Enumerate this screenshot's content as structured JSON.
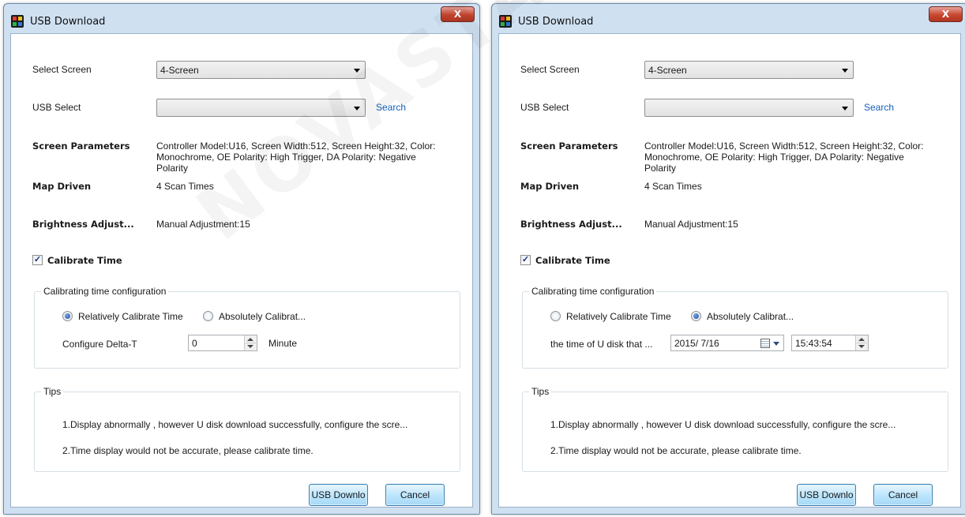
{
  "watermark": "NOVASTAR TECH CO., LTD",
  "colors": {
    "link": "#1560bd",
    "dialog_frame": "#cfe0f1",
    "close": "#c8472f"
  },
  "dialog_left": {
    "title": "USB Download",
    "close_label": "X",
    "select_screen_label": "Select Screen",
    "select_screen_value": "4-Screen",
    "usb_select_label": "USB Select",
    "usb_select_value": "",
    "search_label": "Search",
    "screen_params_label": "Screen Parameters",
    "screen_params_value": "Controller Model:U16, Screen Width:512, Screen Height:32, Color: Monochrome, OE Polarity: High Trigger, DA Polarity: Negative Polarity",
    "map_driven_label": "Map Driven",
    "map_driven_value": "4 Scan Times",
    "brightness_label": "Brightness Adjust...",
    "brightness_value": "Manual Adjustment:15",
    "calibrate_label": "Calibrate Time",
    "calibrate_checked": true,
    "calib_group_title": "Calibrating time configuration",
    "radio_relative": "Relatively Calibrate Time",
    "radio_absolute": "Absolutely Calibrat...",
    "selected_mode": "relative",
    "delta_label": "Configure Delta-T",
    "delta_value": "0",
    "delta_unit": "Minute",
    "tips_title": "Tips",
    "tip1": "1.Display abnormally , however U disk download successfully, configure the scre...",
    "tip2": "2.Time display would not be accurate, please calibrate time.",
    "download_button": "USB Downlo",
    "cancel_button": "Cancel"
  },
  "dialog_right": {
    "title": "USB Download",
    "close_label": "X",
    "select_screen_label": "Select Screen",
    "select_screen_value": "4-Screen",
    "usb_select_label": "USB Select",
    "usb_select_value": "",
    "search_label": "Search",
    "screen_params_label": "Screen Parameters",
    "screen_params_value": "Controller Model:U16, Screen Width:512, Screen Height:32, Color: Monochrome, OE Polarity: High Trigger, DA Polarity: Negative Polarity",
    "map_driven_label": "Map Driven",
    "map_driven_value": "4 Scan Times",
    "brightness_label": "Brightness Adjust...",
    "brightness_value": "Manual Adjustment:15",
    "calibrate_label": "Calibrate Time",
    "calibrate_checked": true,
    "calib_group_title": "Calibrating time configuration",
    "radio_relative": "Relatively Calibrate Time",
    "radio_absolute": "Absolutely Calibrat...",
    "selected_mode": "absolute",
    "u_disk_time_label": "the time of U disk that ...",
    "date_value": "2015/ 7/16",
    "time_value": "15:43:54",
    "tips_title": "Tips",
    "tip1": "1.Display abnormally , however U disk download successfully, configure the scre...",
    "tip2": "2.Time display would not be accurate, please calibrate time.",
    "download_button": "USB Downlo",
    "cancel_button": "Cancel"
  }
}
